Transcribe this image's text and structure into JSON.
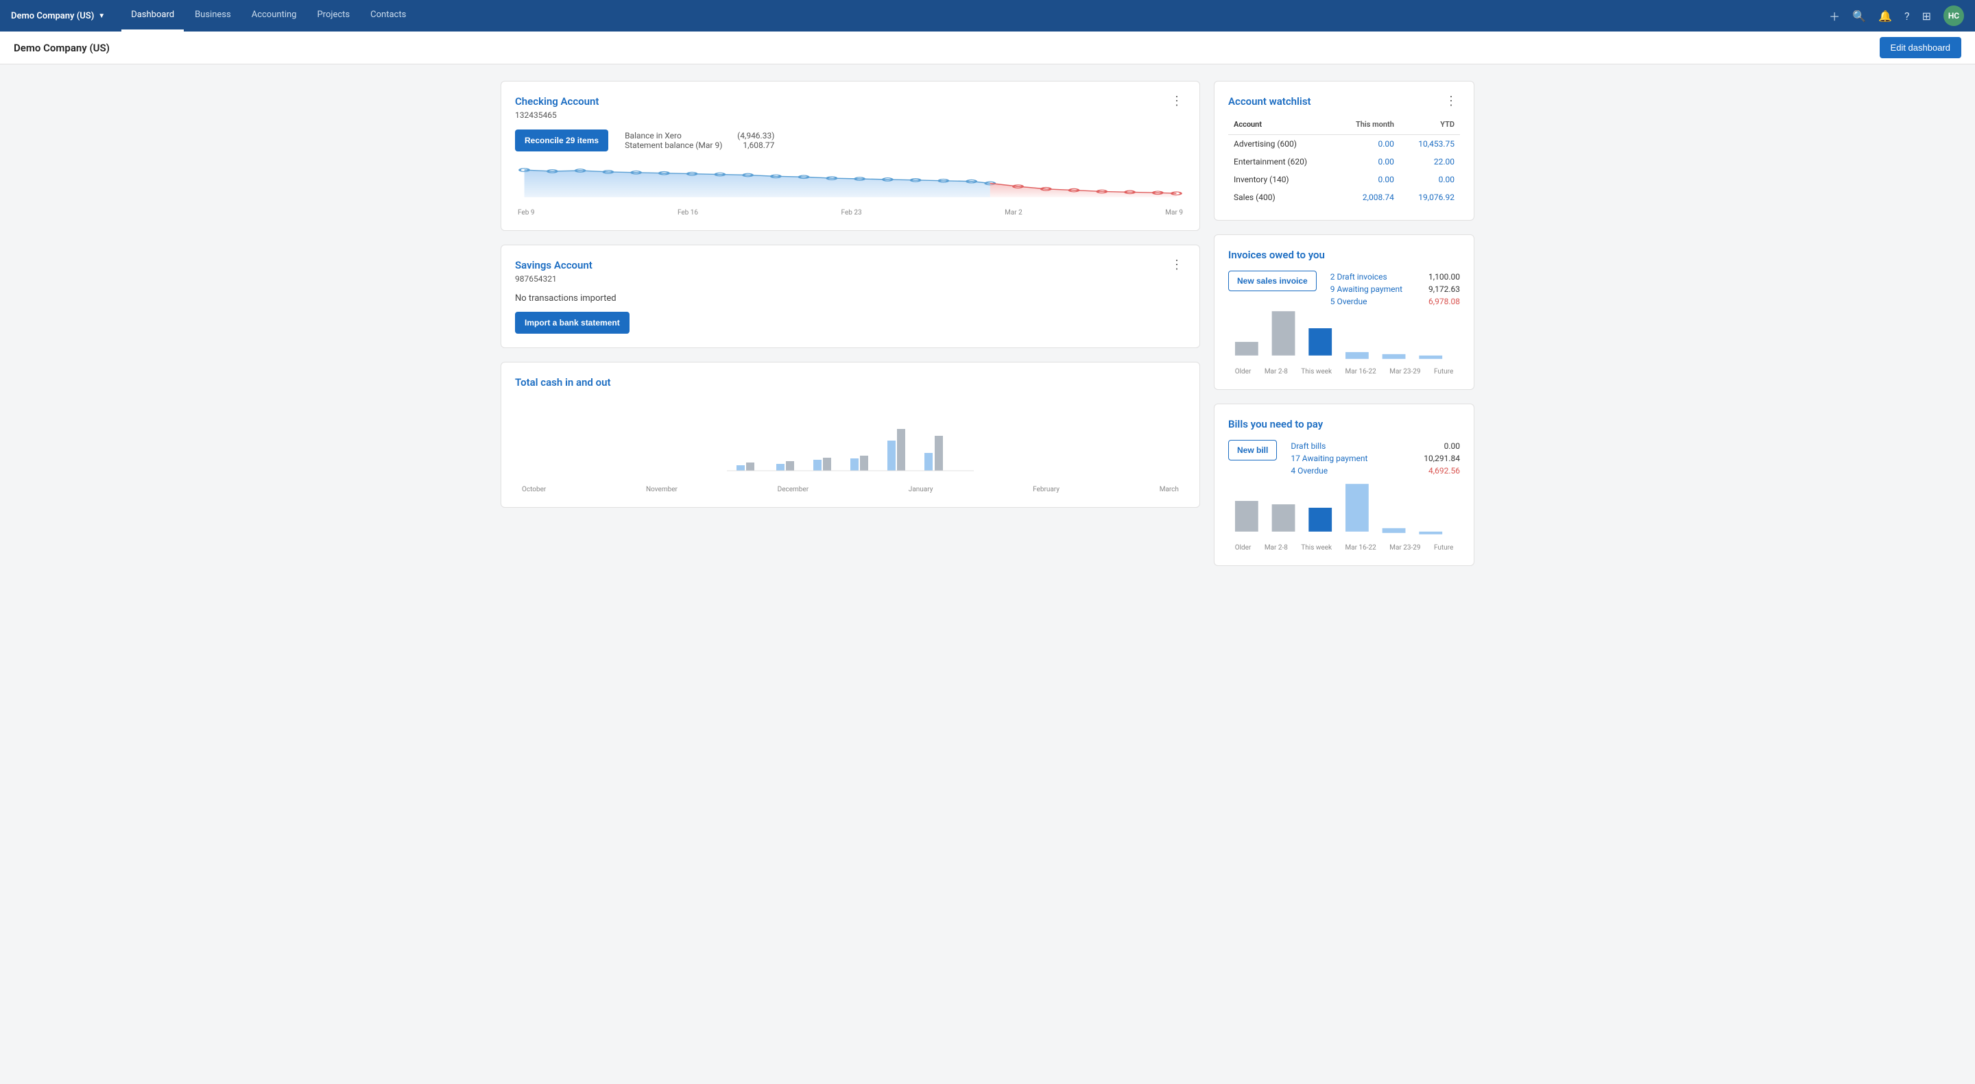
{
  "nav": {
    "brand": "Demo Company (US)",
    "links": [
      "Dashboard",
      "Business",
      "Accounting",
      "Projects",
      "Contacts"
    ],
    "active_link": "Dashboard",
    "avatar": "HC"
  },
  "topbar": {
    "title": "Demo Company (US)",
    "edit_btn": "Edit dashboard"
  },
  "checking_account": {
    "title": "Checking Account",
    "number": "132435465",
    "reconcile_btn": "Reconcile 29 items",
    "balance_label": "Balance in Xero",
    "balance_value": "(4,946.33)",
    "statement_label": "Statement balance (Mar 9)",
    "statement_value": "1,608.77",
    "chart_labels": [
      "Feb 9",
      "Feb 16",
      "Feb 23",
      "Mar 2",
      "Mar 9"
    ]
  },
  "savings_account": {
    "title": "Savings Account",
    "number": "987654321",
    "no_transactions": "No transactions imported",
    "import_btn": "Import a bank statement"
  },
  "total_cash": {
    "title": "Total cash in and out",
    "chart_labels": [
      "October",
      "November",
      "December",
      "January",
      "February",
      "March"
    ]
  },
  "account_watchlist": {
    "title": "Account watchlist",
    "col_month": "This month",
    "col_ytd": "YTD",
    "rows": [
      {
        "account": "Advertising (600)",
        "this_month": "0.00",
        "ytd": "10,453.75",
        "month_class": "val-blue",
        "ytd_class": "val-blue"
      },
      {
        "account": "Entertainment (620)",
        "this_month": "0.00",
        "ytd": "22.00",
        "month_class": "val-blue",
        "ytd_class": "val-blue"
      },
      {
        "account": "Inventory (140)",
        "this_month": "0.00",
        "ytd": "0.00",
        "month_class": "val-blue",
        "ytd_class": "val-blue"
      },
      {
        "account": "Sales (400)",
        "this_month": "2,008.74",
        "ytd": "19,076.92",
        "month_class": "val-blue",
        "ytd_class": "val-blue"
      }
    ]
  },
  "invoices_owed": {
    "title": "Invoices owed to you",
    "new_btn": "New sales invoice",
    "draft_label": "2 Draft invoices",
    "draft_val": "1,100.00",
    "awaiting_label": "9 Awaiting payment",
    "awaiting_val": "9,172.63",
    "overdue_label": "5 Overdue",
    "overdue_val": "6,978.08",
    "bar_labels": [
      "Older",
      "Mar 2-8",
      "This week",
      "Mar 16-22",
      "Mar 23-29",
      "Future"
    ],
    "bars": [
      {
        "height": 30,
        "color": "#b0b8c1"
      },
      {
        "height": 75,
        "color": "#b0b8c1"
      },
      {
        "height": 50,
        "color": "#1c6dc2"
      },
      {
        "height": 15,
        "color": "#9ec8f0"
      },
      {
        "height": 10,
        "color": "#9ec8f0"
      },
      {
        "height": 8,
        "color": "#9ec8f0"
      }
    ]
  },
  "bills": {
    "title": "Bills you need to pay",
    "new_btn": "New bill",
    "draft_label": "Draft bills",
    "draft_val": "0.00",
    "awaiting_label": "17 Awaiting payment",
    "awaiting_val": "10,291.84",
    "overdue_label": "4 Overdue",
    "overdue_val": "4,692.56",
    "bar_labels": [
      "Older",
      "Mar 2-8",
      "This week",
      "Mar 16-22",
      "Mar 23-29",
      "Future"
    ],
    "bars": [
      {
        "height": 55,
        "color": "#b0b8c1"
      },
      {
        "height": 50,
        "color": "#b0b8c1"
      },
      {
        "height": 45,
        "color": "#1c6dc2"
      },
      {
        "height": 80,
        "color": "#9ec8f0"
      },
      {
        "height": 8,
        "color": "#9ec8f0"
      },
      {
        "height": 5,
        "color": "#9ec8f0"
      }
    ]
  }
}
